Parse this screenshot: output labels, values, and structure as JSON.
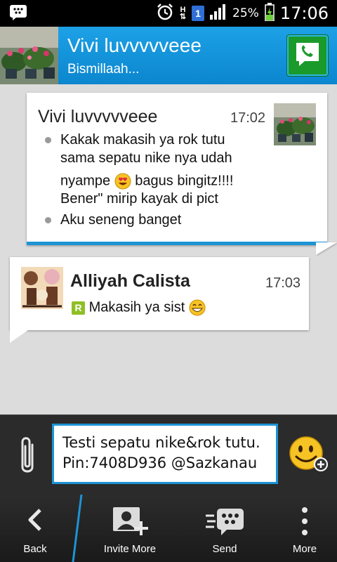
{
  "status_bar": {
    "battery_percent": "25%",
    "time": "17:06",
    "sim_label": "1",
    "network": "H"
  },
  "header": {
    "contact_name": "Vivi luvvvvveee",
    "contact_status": "Bismillaah..."
  },
  "messages": [
    {
      "sender": "Vivi luvvvvveee",
      "time": "17:02",
      "lines": [
        "Kakak makasih ya rok tutu",
        "sama sepatu nike nya udah",
        "nyampe",
        "bagus bingitz!!!!",
        "Bener\" mirip kayak di pict",
        "Aku seneng banget"
      ]
    },
    {
      "sender": "Alliyah Calista",
      "time": "17:03",
      "read_badge": "R",
      "text": "Makasih ya sist"
    }
  ],
  "compose": {
    "line1": "Testi sepatu nike&rok tutu.",
    "line2": "Pin:7408D936 @Sazkanau"
  },
  "toolbar": {
    "back": "Back",
    "invite": "Invite More",
    "send": "Send",
    "more": "More"
  },
  "colors": {
    "header_blue": "#1da1e6",
    "accent_blue": "#1d94d4",
    "call_green": "#1a9a2a"
  }
}
